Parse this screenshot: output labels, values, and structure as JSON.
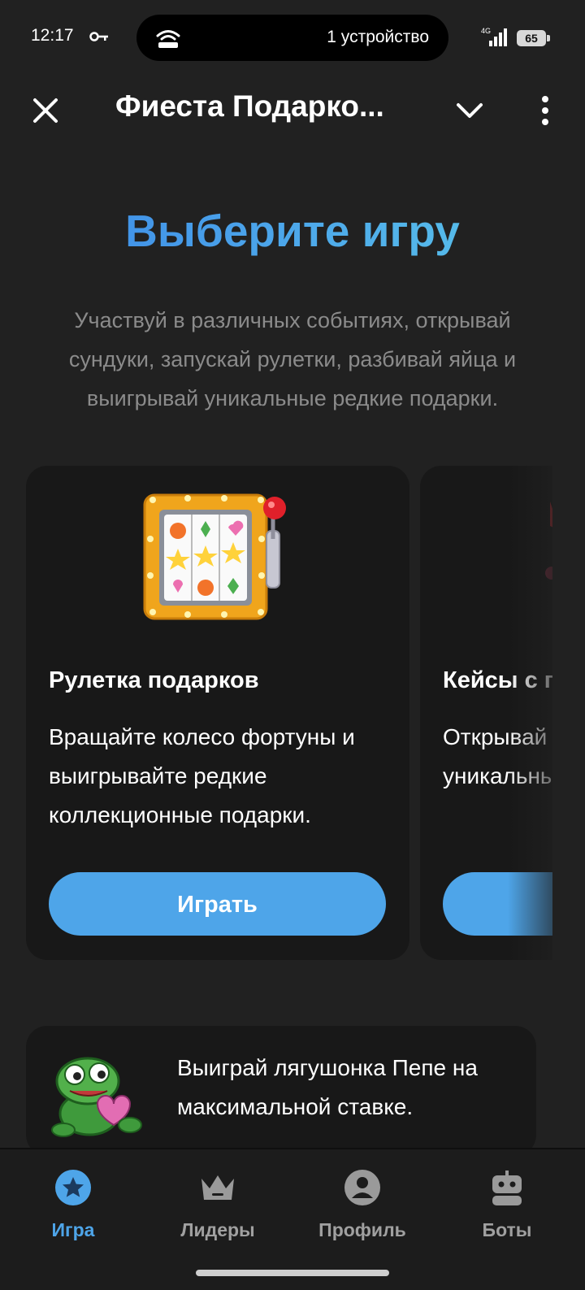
{
  "status_bar": {
    "time": "12:17",
    "pill_text": "1 устройство",
    "network": "4G",
    "battery": "65",
    "icons": [
      "key-icon",
      "hotspot-icon",
      "signal-icon",
      "battery-icon"
    ]
  },
  "header": {
    "title": "Фиеста Подарко...",
    "icons": [
      "close-icon",
      "chevron-down-icon",
      "more-vertical-icon"
    ]
  },
  "main": {
    "title": "Выберите игру",
    "subtitle": "Участвуй в различных событиях, открывай сундуки, запускай рулетки, разбивай яйца и выигрывай уникальные редкие подарки.",
    "cards": [
      {
        "title": "Рулетка подарков",
        "description": "Вращайте колесо фортуны и выигрывайте редкие коллекционные подарки.",
        "button": "Играть",
        "icon": "slot-machine-icon"
      },
      {
        "title": "Кейсы с п",
        "description": "Открывай кейсы и по уникальны",
        "button": "",
        "icon": "case-icon"
      }
    ],
    "promo": {
      "text": "Выиграй лягушонка Пепе на максимальной ставке.",
      "icon": "pepe-frog-icon"
    }
  },
  "bottom_nav": {
    "items": [
      {
        "label": "Игра",
        "icon": "star-icon",
        "active": true
      },
      {
        "label": "Лидеры",
        "icon": "crown-icon",
        "active": false
      },
      {
        "label": "Профиль",
        "icon": "profile-icon",
        "active": false
      },
      {
        "label": "Боты",
        "icon": "robot-icon",
        "active": false
      }
    ]
  },
  "colors": {
    "background": "#212121",
    "card": "#181818",
    "accent": "#4ea5e9",
    "muted_text": "#8b8b8b"
  }
}
